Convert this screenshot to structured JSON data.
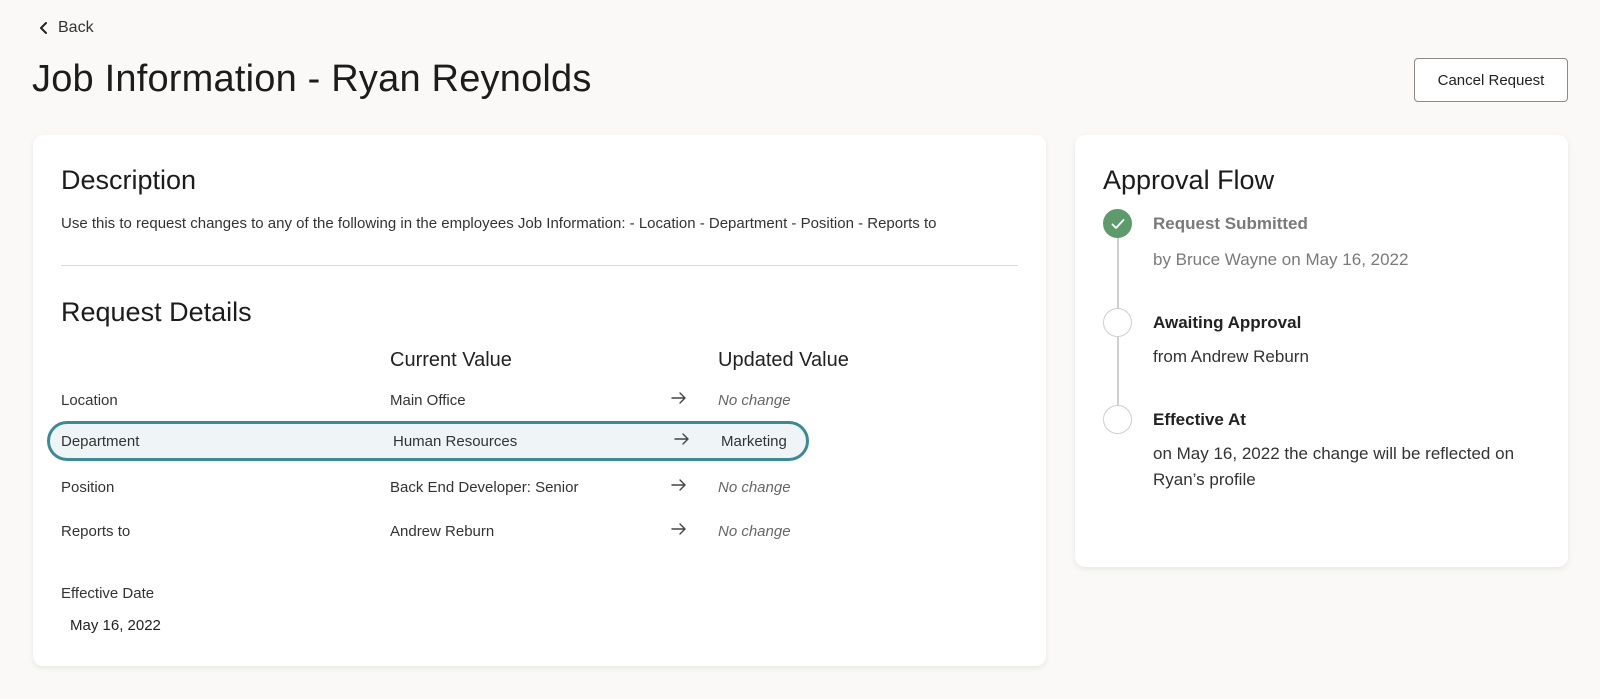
{
  "nav": {
    "back_label": "Back"
  },
  "header": {
    "title": "Job Information - Ryan Reynolds",
    "cancel_label": "Cancel Request"
  },
  "description": {
    "title": "Description",
    "text": "Use this to request changes to any of the following in the employees Job Information: - Location - Department - Position - Reports to"
  },
  "request_details": {
    "title": "Request Details",
    "columns": {
      "current": "Current Value",
      "updated": "Updated Value"
    },
    "rows": [
      {
        "field": "Location",
        "current": "Main Office",
        "updated": "No change"
      },
      {
        "field": "Department",
        "current": "Human Resources",
        "updated": "Marketing"
      },
      {
        "field": "Position",
        "current": "Back End Developer: Senior",
        "updated": "No change"
      },
      {
        "field": "Reports to",
        "current": "Andrew Reburn",
        "updated": "No change"
      }
    ],
    "effective_label": "Effective Date",
    "effective_value": "May 16, 2022"
  },
  "approval_flow": {
    "title": "Approval Flow",
    "steps": [
      {
        "title": "Request Submitted",
        "subtitle": "by Bruce Wayne on May 16, 2022",
        "status": "done"
      },
      {
        "title": "Awaiting Approval",
        "subtitle": "from Andrew Reburn",
        "status": "pending"
      },
      {
        "title": "Effective At",
        "subtitle": "on May 16, 2022 the change will be reflected on Ryan’s profile",
        "status": "pending"
      }
    ]
  },
  "colors": {
    "accent": "#3e8a93",
    "success": "#5f9a6c",
    "highlight_bg": "#eff4f6"
  },
  "icons": {
    "back": "chevron-left-icon",
    "arrow": "arrow-right-icon",
    "check": "check-icon"
  }
}
